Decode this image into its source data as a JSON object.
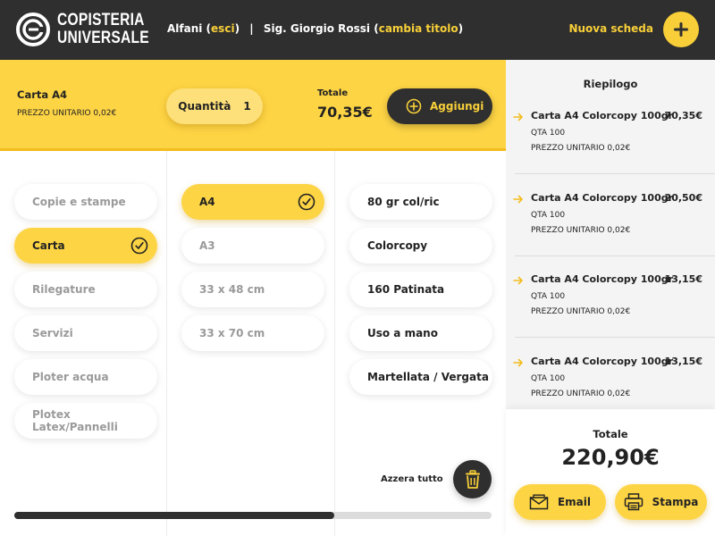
{
  "header": {
    "logo_line1": "COPISTERIA",
    "logo_line2": "UNIVERSALE",
    "operator": "Alfani",
    "logout_label": "esci",
    "customer": "Sig. Giorgio Rossi",
    "change_title_label": "cambia titolo",
    "new_tab_label": "Nuova scheda",
    "new_tab_icon": "plus-icon"
  },
  "product_bar": {
    "product_name": "Carta A4",
    "unit_price": "PREZZO UNITARIO 0,02€",
    "quantity_label": "Quantità",
    "quantity_value": "1",
    "total_label": "Totale",
    "total_value": "70,35€",
    "add_label": "Aggiungi",
    "add_icon": "plus-circle-icon"
  },
  "categories": [
    {
      "label": "Copie e stampe",
      "state": "muted"
    },
    {
      "label": "Carta",
      "state": "active"
    },
    {
      "label": "Rilegature",
      "state": "muted"
    },
    {
      "label": "Servizi",
      "state": "muted"
    },
    {
      "label": "Ploter acqua",
      "state": "muted"
    },
    {
      "label": "Plotex Latex/Pannelli",
      "state": "muted"
    }
  ],
  "formats": [
    {
      "label": "A4",
      "state": "active"
    },
    {
      "label": "A3",
      "state": "muted"
    },
    {
      "label": "33 x 48 cm",
      "state": "muted"
    },
    {
      "label": "33 x 70 cm",
      "state": "muted"
    }
  ],
  "types": [
    {
      "label": "80 gr col/ric"
    },
    {
      "label": "Colorcopy"
    },
    {
      "label": "160 Patinata"
    },
    {
      "label": "Uso a mano"
    },
    {
      "label": "Martellata / Vergata"
    }
  ],
  "actions": {
    "reset_label": "Azzera tutto",
    "reset_icon": "trash-icon",
    "scroll_progress": 0.67
  },
  "summary": {
    "title": "Riepilogo",
    "items": [
      {
        "name": "Carta A4 Colorcopy 100gr",
        "price": "70,35€",
        "qty": "QTA 100",
        "unit": "PREZZO UNITARIO 0,02€"
      },
      {
        "name": "Carta A4 Colorcopy 100gr",
        "price": "20,50€",
        "qty": "QTA 100",
        "unit": "PREZZO UNITARIO 0,02€"
      },
      {
        "name": "Carta A4 Colorcopy 100gr",
        "price": "13,15€",
        "qty": "QTA 100",
        "unit": "PREZZO UNITARIO 0,02€"
      },
      {
        "name": "Carta A4 Colorcopy 100gr",
        "price": "13,15€",
        "qty": "QTA 100",
        "unit": "PREZZO UNITARIO 0,02€"
      }
    ],
    "total_label": "Totale",
    "total_value": "220,90€",
    "email_label": "Email",
    "print_label": "Stampa"
  },
  "colors": {
    "accent": "#fdd444",
    "dark": "#2f2f2f",
    "panel": "#f4f4f4"
  }
}
